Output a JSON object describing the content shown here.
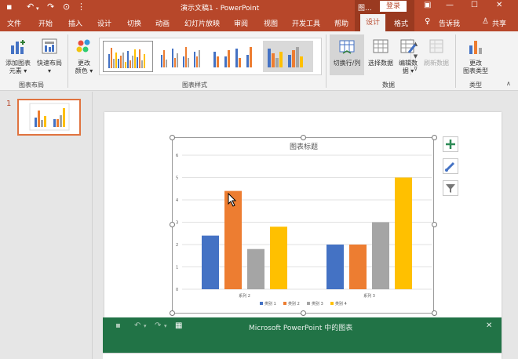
{
  "window": {
    "title": "演示文稿1  -  PowerPoint",
    "context_label": "图...",
    "login_label": "登录"
  },
  "menu": {
    "items": [
      "文件",
      "开始",
      "插入",
      "设计",
      "切换",
      "动画",
      "幻灯片放映",
      "审阅",
      "视图",
      "开发工具",
      "帮助"
    ],
    "active_tab": "设计",
    "format_tab": "格式",
    "tell_me": "告诉我",
    "share": "共享"
  },
  "ribbon": {
    "add_element": "添加图表\n元素 ▾",
    "quick_layout": "快速布局\n▾",
    "group_layout": "图表布局",
    "change_colors": "更改\n颜色 ▾",
    "group_styles": "图表样式",
    "switch_row_col": "切换行/列",
    "select_data": "选择数据",
    "edit_data": "编辑数\n据 ▾",
    "refresh_data": "刷新数据",
    "group_data": "数据",
    "change_type": "更改\n图表类型",
    "group_type": "类型"
  },
  "slides": {
    "number": "1"
  },
  "chart_data": {
    "type": "bar",
    "title": "图表标题",
    "categories": [
      "系列 2",
      "系列 3"
    ],
    "series": [
      {
        "name": "类别 1",
        "values": [
          2.4,
          2.0
        ],
        "color": "#4472c4"
      },
      {
        "name": "类别 2",
        "values": [
          4.4,
          2.0
        ],
        "color": "#ed7d31"
      },
      {
        "name": "类别 3",
        "values": [
          1.8,
          3.0
        ],
        "color": "#a5a5a5"
      },
      {
        "name": "类别 4",
        "values": [
          2.8,
          5.0
        ],
        "color": "#ffc000"
      }
    ],
    "ylim": [
      0,
      6
    ],
    "yticks": [
      "0",
      "1",
      "2",
      "3",
      "4",
      "5",
      "6"
    ],
    "grid": true,
    "legend": "bottom"
  },
  "data_window": {
    "title": "Microsoft PowerPoint 中的图表"
  },
  "colors": {
    "ppt_accent": "#b7472a",
    "excel_green": "#217346"
  }
}
